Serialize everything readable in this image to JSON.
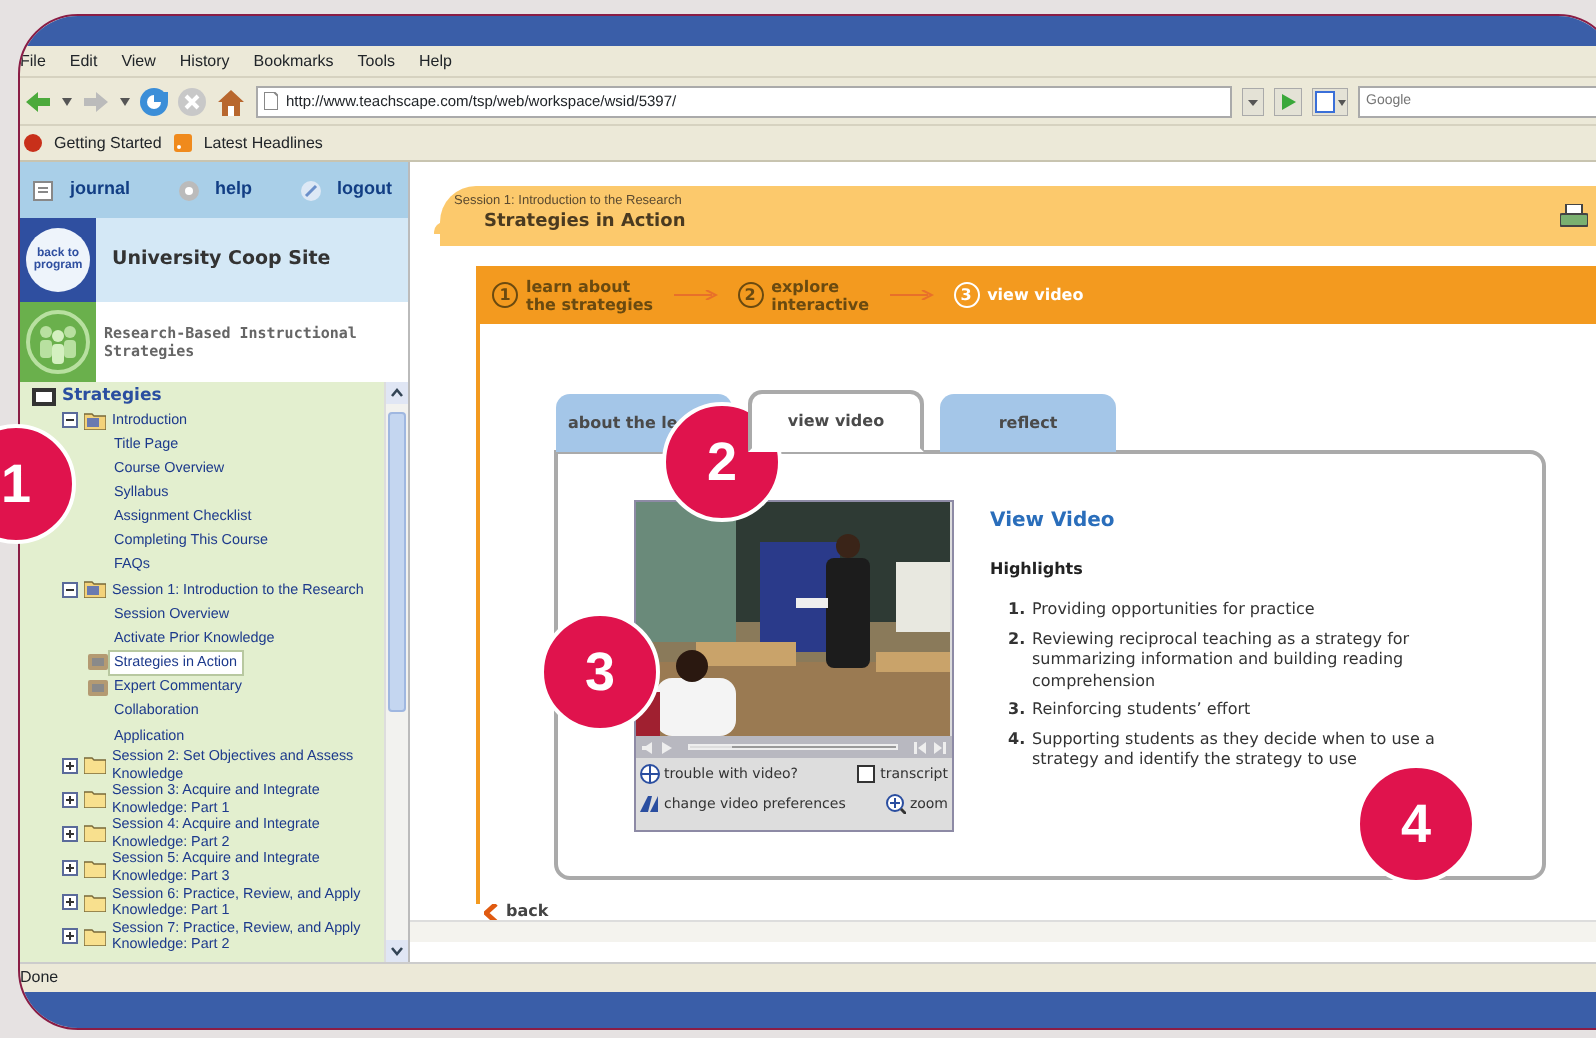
{
  "menu": [
    "File",
    "Edit",
    "View",
    "History",
    "Bookmarks",
    "Tools",
    "Help"
  ],
  "address": "http://www.teachscape.com/tsp/web/workspace/wsid/5397/",
  "search": {
    "placeholder": "Google"
  },
  "bookmarks": [
    "Getting Started",
    "Latest Headlines"
  ],
  "sidebar": {
    "links": [
      "journal",
      "help",
      "logout"
    ],
    "back_badge": "back to program",
    "site": "University Coop Site",
    "program": "Research-Based Instructional Strategies",
    "tree": {
      "label": "Strategies",
      "kind": "root",
      "expanded": true,
      "children": [
        {
          "label": "Introduction",
          "kind": "folder",
          "expanded": true,
          "children": [
            {
              "label": "Title Page",
              "kind": "page",
              "selected": false
            },
            {
              "label": "Course Overview",
              "kind": "page",
              "selected": false
            },
            {
              "label": "Syllabus",
              "kind": "page",
              "selected": false
            },
            {
              "label": "Assignment Checklist",
              "kind": "page",
              "selected": false
            },
            {
              "label": "Completing This Course",
              "kind": "page",
              "selected": false
            },
            {
              "label": "FAQs",
              "kind": "page",
              "selected": false
            }
          ]
        },
        {
          "label": "Session 1: Introduction to the Research",
          "kind": "folder",
          "expanded": true,
          "children": [
            {
              "label": "Session Overview",
              "kind": "page",
              "selected": false
            },
            {
              "label": "Activate Prior Knowledge",
              "kind": "page",
              "selected": false
            },
            {
              "label": "Strategies in Action",
              "kind": "media",
              "selected": true
            },
            {
              "label": "Expert Commentary",
              "kind": "media",
              "selected": false
            },
            {
              "label": "Collaboration",
              "kind": "page",
              "selected": false
            },
            {
              "label": "Application",
              "kind": "page",
              "selected": false
            }
          ]
        },
        {
          "label": "Session 2: Set Objectives and Assess Knowledge",
          "kind": "folder",
          "expanded": false
        },
        {
          "label": "Session 3: Acquire and Integrate Knowledge: Part 1",
          "kind": "folder",
          "expanded": false
        },
        {
          "label": "Session 4: Acquire and Integrate Knowledge: Part 2",
          "kind": "folder",
          "expanded": false
        },
        {
          "label": "Session 5: Acquire and Integrate Knowledge: Part 3",
          "kind": "folder",
          "expanded": false
        },
        {
          "label": "Session 6: Practice, Review, and Apply Knowledge: Part 1",
          "kind": "folder",
          "expanded": false
        },
        {
          "label": "Session 7: Practice, Review, and Apply Knowledge: Part 2",
          "kind": "folder",
          "expanded": false
        }
      ]
    }
  },
  "header": {
    "session": "Session 1: Introduction to the Research",
    "title": "Strategies in Action"
  },
  "steps": [
    {
      "number": "1",
      "lines": [
        "learn about",
        "the strategies"
      ],
      "selected": false
    },
    {
      "number": "2",
      "lines": [
        "explore",
        "interactive"
      ],
      "selected": false
    },
    {
      "number": "3",
      "lines": [
        "view video"
      ],
      "selected": true
    }
  ],
  "tabs": [
    {
      "label": "about the le",
      "selected": false
    },
    {
      "label": "view video",
      "selected": true
    },
    {
      "label": "reflect",
      "selected": false
    }
  ],
  "video": {
    "trouble": "trouble with video?",
    "transcript": "transcript",
    "preferences": "change video preferences",
    "zoom": "zoom",
    "level": 0.2
  },
  "content": {
    "heading": "View Video",
    "subheading": "Highlights",
    "items": [
      {
        "number": "1.",
        "text": "Providing opportunities for practice"
      },
      {
        "number": "2.",
        "text": "Reviewing reciprocal teaching as a strategy for summarizing information and building reading comprehension"
      },
      {
        "number": "3.",
        "text": "Reinforcing students’ effort"
      },
      {
        "number": "4.",
        "text": "Supporting students as they decide when to use a strategy and identify the strategy to use"
      }
    ]
  },
  "back": "back",
  "status": "Done",
  "annotations": [
    "1",
    "2",
    "3",
    "4"
  ]
}
